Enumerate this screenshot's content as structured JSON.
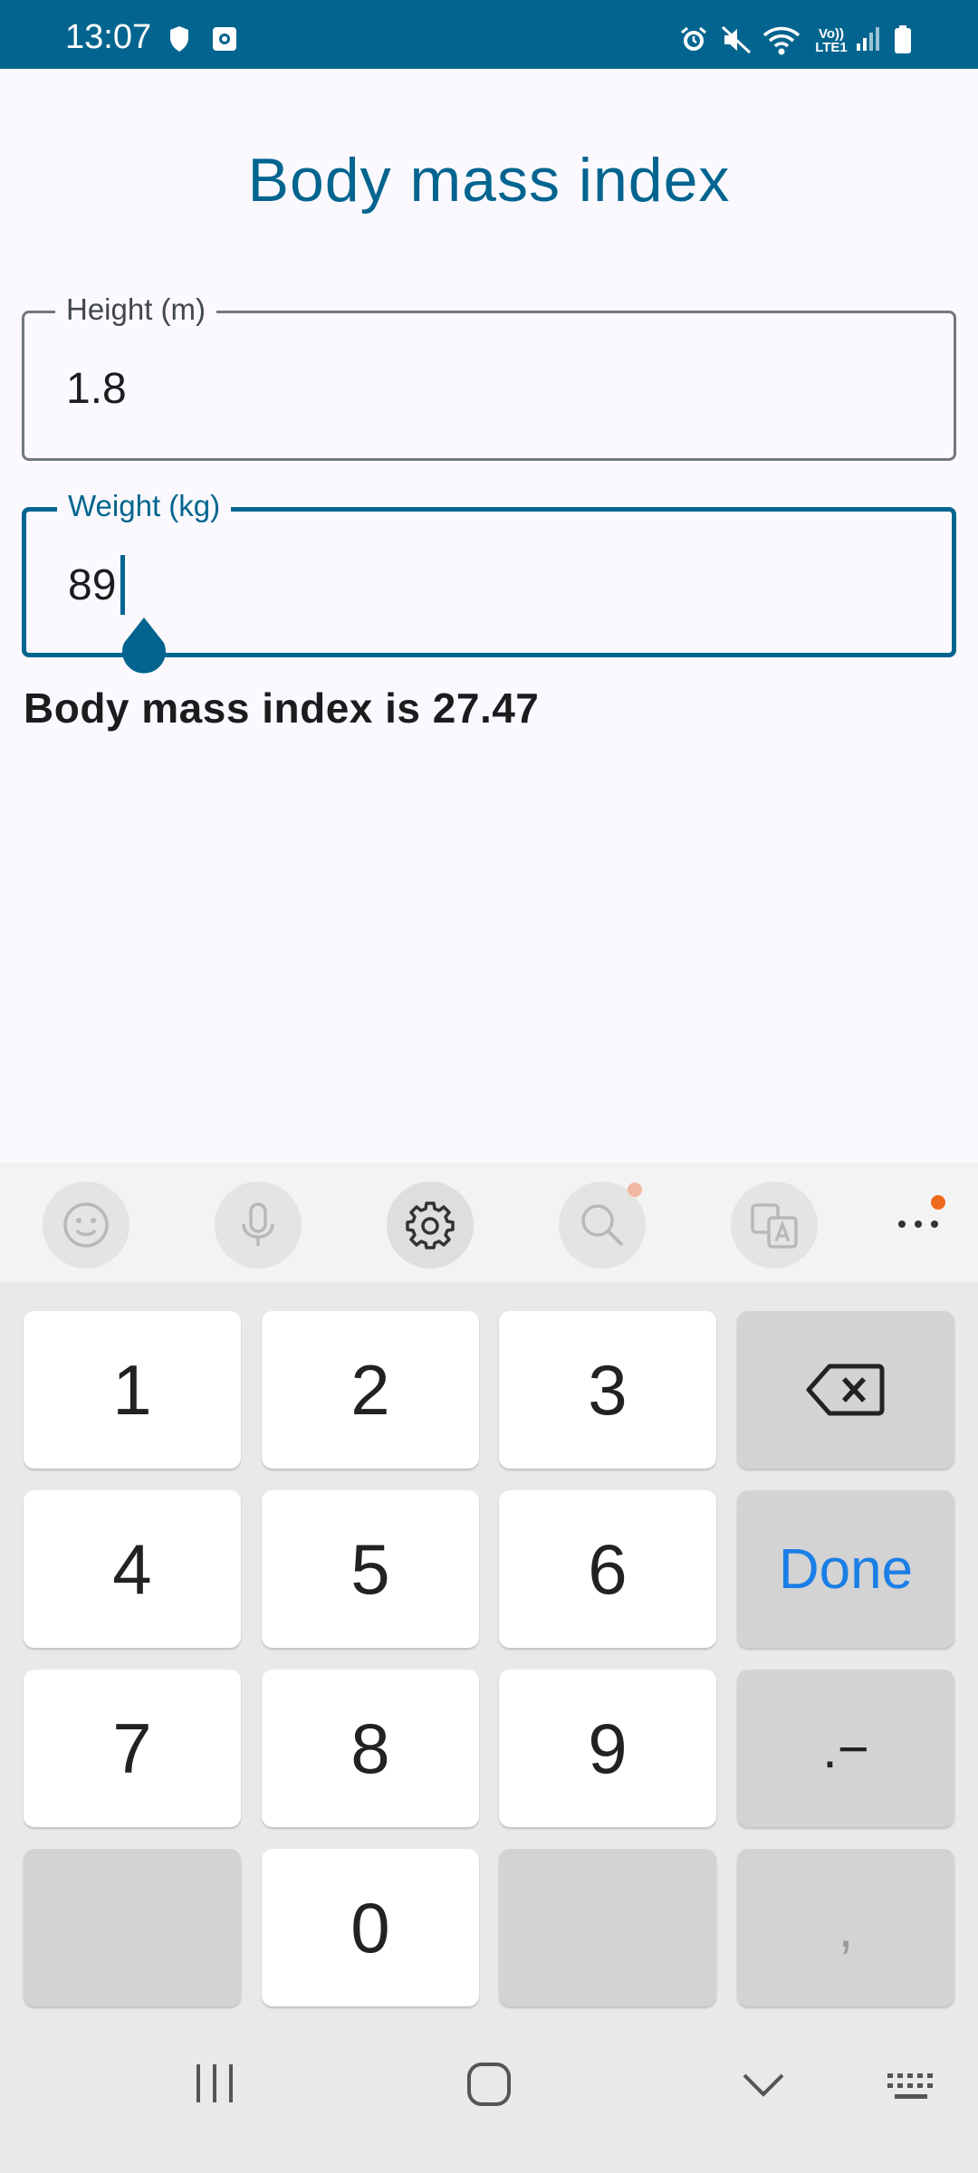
{
  "status_bar": {
    "time": "13:07",
    "network_label": "Vo)) LTE1",
    "icons": [
      "shield-icon",
      "screenshot-icon",
      "alarm-icon",
      "mute-icon",
      "wifi-icon",
      "signal-icon",
      "battery-icon"
    ]
  },
  "app": {
    "title": "Body mass index",
    "height_field": {
      "label": "Height (m)",
      "value": "1.8"
    },
    "weight_field": {
      "label": "Weight (kg)",
      "value": "89"
    },
    "result": "Body mass index is 27.47",
    "accent_color": "#03658f"
  },
  "keyboard": {
    "toolbar": [
      "emoji-icon",
      "microphone-icon",
      "settings-icon",
      "search-icon",
      "translate-icon",
      "more-icon"
    ],
    "keys": {
      "k1": "1",
      "k2": "2",
      "k3": "3",
      "k4": "4",
      "k5": "5",
      "k6": "6",
      "k7": "7",
      "k8": "8",
      "k9": "9",
      "k0": "0",
      "done": "Done",
      "symbols": ".−",
      "comma": ","
    },
    "done_color": "#1a7fe6"
  },
  "nav_bar": [
    "recents-icon",
    "home-icon",
    "back-icon",
    "keyboard-switch-icon"
  ]
}
